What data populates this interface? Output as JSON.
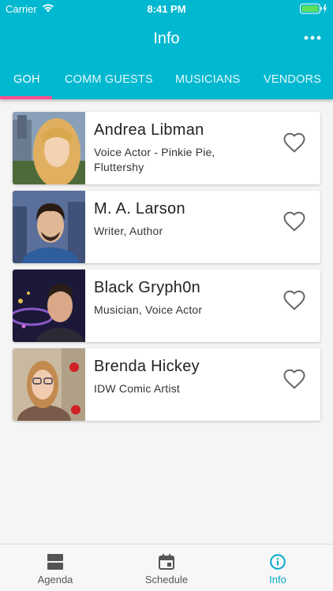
{
  "status_bar": {
    "carrier": "Carrier",
    "time": "8:41 PM"
  },
  "header": {
    "title": "Info"
  },
  "tabs": [
    {
      "label": "GOH",
      "active": true
    },
    {
      "label": "COMM GUESTS"
    },
    {
      "label": "MUSICIANS"
    },
    {
      "label": "VENDORS"
    }
  ],
  "guests": [
    {
      "name": "Andrea Libman",
      "role": "Voice Actor - Pinkie Pie, Fluttershy"
    },
    {
      "name": "M. A. Larson",
      "role": "Writer, Author"
    },
    {
      "name": "Black Gryph0n",
      "role": "Musician, Voice Actor"
    },
    {
      "name": "Brenda Hickey",
      "role": "IDW Comic Artist"
    }
  ],
  "bottom_nav": [
    {
      "label": "Agenda",
      "icon": "agenda-icon"
    },
    {
      "label": "Schedule",
      "icon": "calendar-icon"
    },
    {
      "label": "Info",
      "icon": "info-icon",
      "active": true
    }
  ],
  "colors": {
    "primary": "#00b8d0",
    "accent": "#ff4f90",
    "active_nav": "#00a8c8"
  }
}
